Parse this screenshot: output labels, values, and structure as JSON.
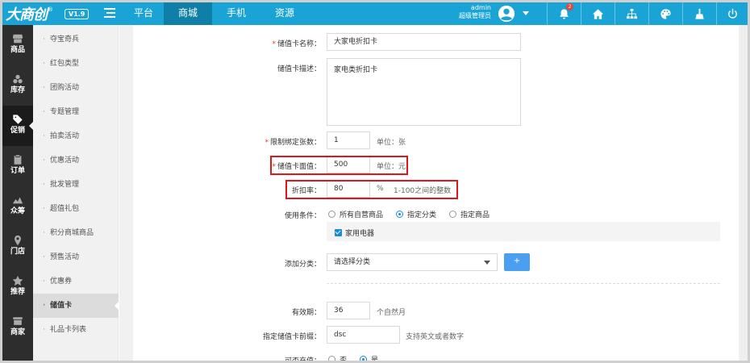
{
  "header": {
    "logo_text": "大商创",
    "logo_reg": "®",
    "version": "V1.9",
    "tabs": [
      {
        "label": "平台",
        "active": false
      },
      {
        "label": "商城",
        "active": true
      },
      {
        "label": "手机",
        "active": false
      },
      {
        "label": "资源",
        "active": false
      }
    ],
    "user_name": "admin",
    "user_role": "超级管理员",
    "notification_count": "2",
    "icons": [
      "bell-icon",
      "home-icon",
      "sitemap-icon",
      "palette-icon",
      "broom-icon",
      "power-icon"
    ]
  },
  "sidebar": {
    "items": [
      {
        "label": "商品",
        "icon": "shop-icon"
      },
      {
        "label": "库存",
        "icon": "cubes-icon"
      },
      {
        "label": "促销",
        "icon": "tag-icon",
        "active": true
      },
      {
        "label": "订单",
        "icon": "clipboard-icon"
      },
      {
        "label": "众筹",
        "icon": "rise-icon"
      },
      {
        "label": "门店",
        "icon": "location-icon"
      },
      {
        "label": "推荐",
        "icon": "star-icon"
      },
      {
        "label": "商家",
        "icon": "store-icon"
      }
    ]
  },
  "submenu": {
    "items": [
      {
        "label": "夺宝奇兵"
      },
      {
        "label": "红包类型"
      },
      {
        "label": "团购活动"
      },
      {
        "label": "专题管理"
      },
      {
        "label": "拍卖活动"
      },
      {
        "label": "优惠活动"
      },
      {
        "label": "批发管理"
      },
      {
        "label": "超值礼包"
      },
      {
        "label": "积分商城商品"
      },
      {
        "label": "预售活动"
      },
      {
        "label": "优惠券"
      },
      {
        "label": "储值卡",
        "active": true
      },
      {
        "label": "礼品卡列表"
      }
    ]
  },
  "form": {
    "required_mark": "*",
    "card_name": {
      "label": "储值卡名称：",
      "value": "大家电折扣卡"
    },
    "card_desc": {
      "label": "储值卡描述：",
      "value": "家电类折扣卡"
    },
    "bind_limit": {
      "label": "限制绑定张数：",
      "value": "1",
      "unit": "单位：张"
    },
    "face_value": {
      "label": "储值卡面值：",
      "value": "500",
      "unit": "单位：元"
    },
    "discount": {
      "label": "折扣率：",
      "value": "80",
      "unit": "%",
      "hint": "1-100之间的整数"
    },
    "use_condition": {
      "label": "使用条件：",
      "options": [
        {
          "label": "所有自营商品",
          "checked": false
        },
        {
          "label": "指定分类",
          "checked": true
        },
        {
          "label": "指定商品",
          "checked": false
        }
      ],
      "selected_category": "家用电器"
    },
    "add_category": {
      "label": "添加分类：",
      "placeholder": "请选择分类",
      "button": "+"
    },
    "validity": {
      "label": "有效期：",
      "value": "36",
      "unit": "个自然月"
    },
    "prefix": {
      "label": "指定储值卡前缀：",
      "value": "dsc",
      "hint": "支持英文或者数字"
    },
    "recharge": {
      "label": "可否充值：",
      "options": [
        {
          "label": "否",
          "checked": false
        },
        {
          "label": "是",
          "checked": true
        }
      ]
    }
  },
  "colors": {
    "header_bg": "#1aa4d6",
    "sidebar_bg": "#2d2d2d",
    "highlight": "#e0161b",
    "accent": "#1a8bd6"
  }
}
